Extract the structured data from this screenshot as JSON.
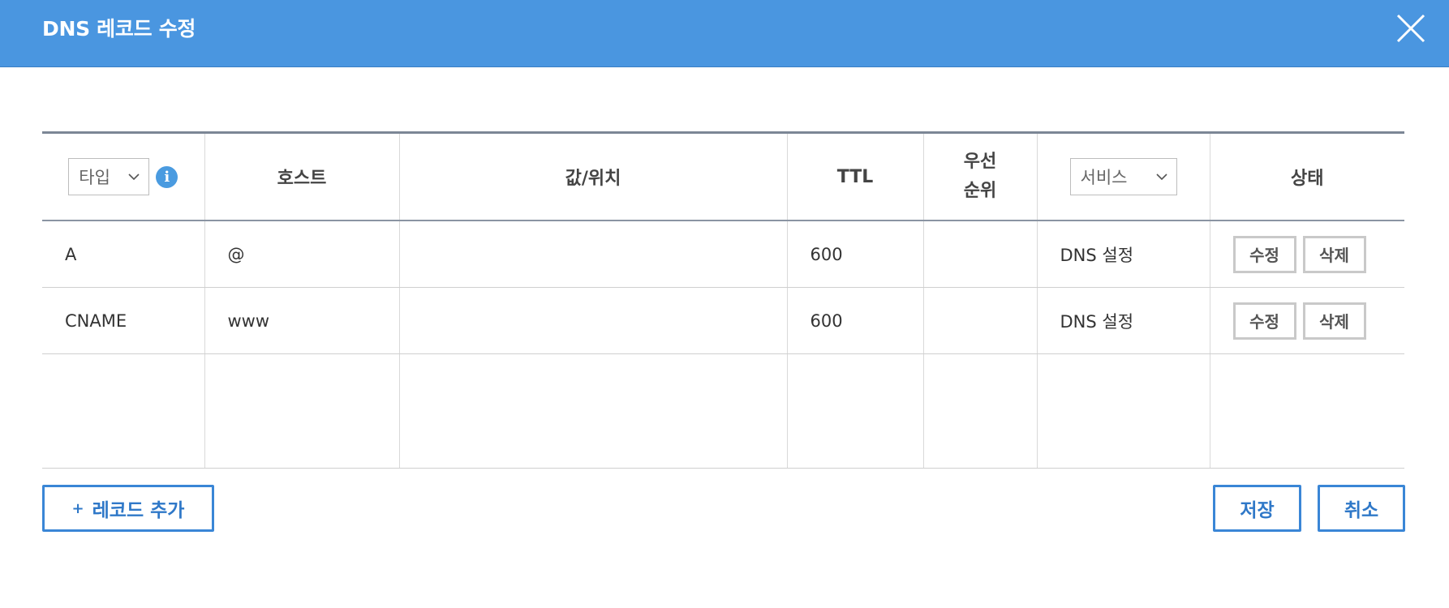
{
  "dialog": {
    "title": "DNS 레코드 수정",
    "close_icon": "close-icon"
  },
  "table": {
    "headers": {
      "type_select": "타입",
      "host": "호스트",
      "value": "값/위치",
      "ttl": "TTL",
      "priority_line1": "우선",
      "priority_line2": "순위",
      "service_select": "서비스",
      "status": "상태"
    },
    "rows": [
      {
        "type": "A",
        "host": "@",
        "value": "",
        "ttl": "600",
        "priority": "",
        "service": "DNS 설정",
        "edit": "수정",
        "delete": "삭제"
      },
      {
        "type": "CNAME",
        "host": "www",
        "value": "",
        "ttl": "600",
        "priority": "",
        "service": "DNS 설정",
        "edit": "수정",
        "delete": "삭제"
      }
    ]
  },
  "footer": {
    "add_record_plus": "+",
    "add_record": "레코드 추가",
    "save": "저장",
    "cancel": "취소"
  },
  "colors": {
    "titlebar": "#4a96e0",
    "accent": "#3a86d6"
  }
}
